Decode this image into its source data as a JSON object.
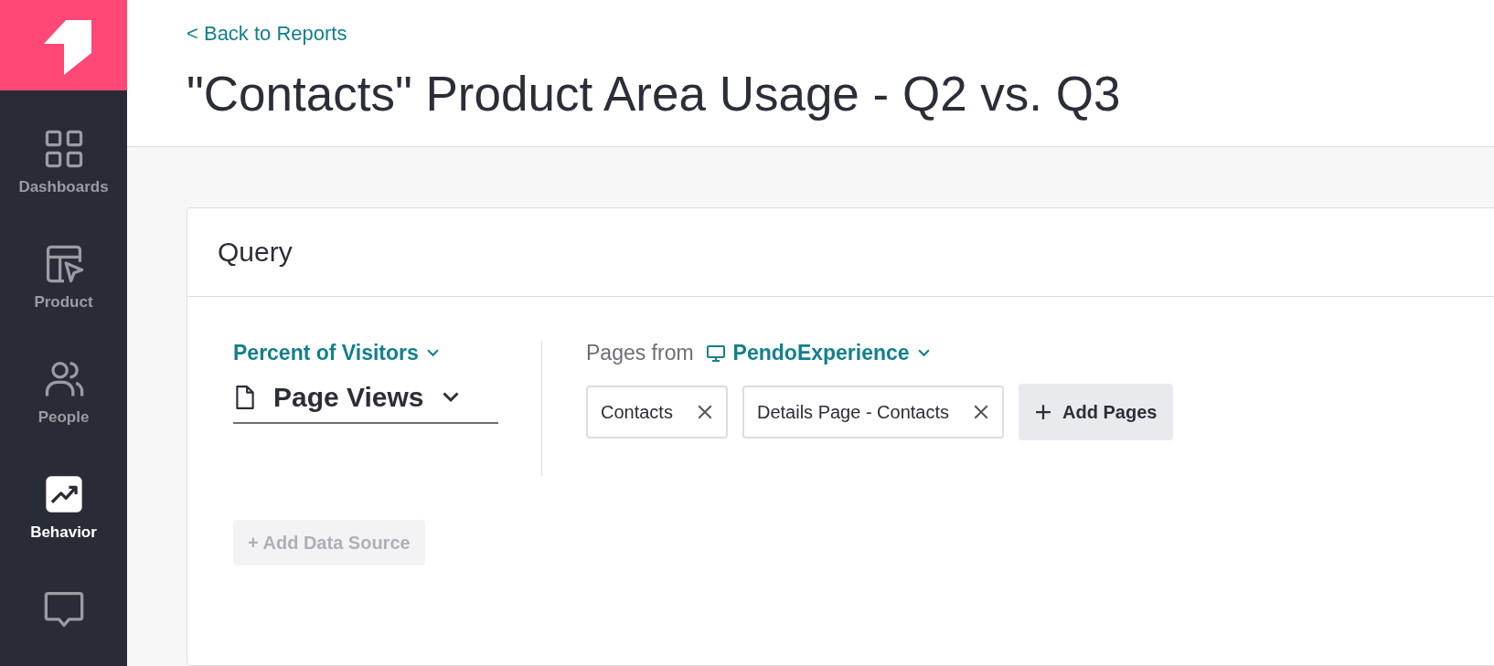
{
  "sidebar": {
    "items": [
      {
        "kind": "dashboards",
        "label": "Dashboards",
        "selected": false
      },
      {
        "kind": "product",
        "label": "Product",
        "selected": false
      },
      {
        "kind": "people",
        "label": "People",
        "selected": false
      },
      {
        "kind": "behavior",
        "label": "Behavior",
        "selected": true
      },
      {
        "kind": "messages",
        "selected": false
      }
    ]
  },
  "header": {
    "back_link": "< Back to Reports",
    "title": "\"Contacts\" Product Area Usage - Q2 vs. Q3"
  },
  "query": {
    "title": "Query",
    "metric": "Percent of Visitors",
    "event_type": "Page Views",
    "pages_from_label": "Pages from",
    "app": "PendoExperience",
    "pages": [
      "Contacts",
      "Details Page - Contacts"
    ],
    "add_pages": "Add Pages",
    "add_data_source": {
      "label": "+ Add Data Source",
      "disabled": true
    }
  }
}
